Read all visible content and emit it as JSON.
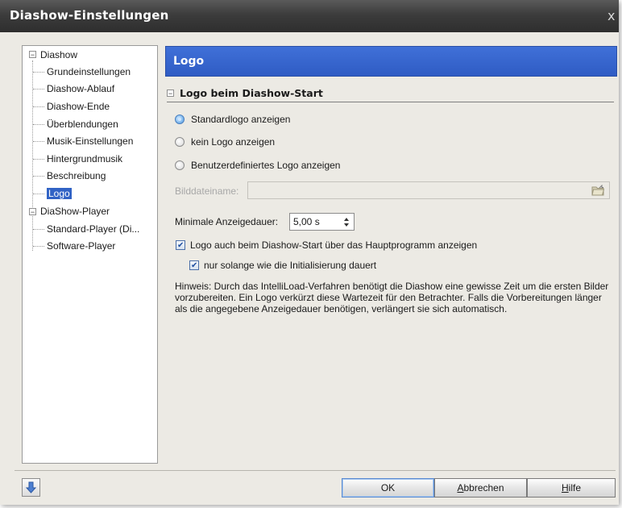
{
  "window": {
    "title": "Diashow-Einstellungen",
    "close_glyph": "x"
  },
  "tree": {
    "root1": {
      "label": "Diashow",
      "expander": "−"
    },
    "children1": [
      "Grundeinstellungen",
      "Diashow-Ablauf",
      "Diashow-Ende",
      "Überblendungen",
      "Musik-Einstellungen",
      "Hintergrundmusik",
      "Beschreibung",
      "Logo"
    ],
    "selected": "Logo",
    "root2": {
      "label": "DiaShow-Player",
      "expander": "−"
    },
    "children2": [
      "Standard-Player (Di...",
      "Software-Player"
    ]
  },
  "panel": {
    "header": "Logo",
    "group_title": "Logo beim Diashow-Start",
    "radios": [
      {
        "label": "Standardlogo anzeigen",
        "checked": true
      },
      {
        "label": "kein Logo anzeigen",
        "checked": false
      },
      {
        "label": "Benutzerdefiniertes Logo anzeigen",
        "checked": false
      }
    ],
    "file_label": "Bilddateiname:",
    "file_value": "",
    "duration_label": "Minimale Anzeigedauer:",
    "duration_value": "5,00 s",
    "check1": {
      "label": "Logo auch beim Diashow-Start über das Hauptprogramm anzeigen",
      "checked": true
    },
    "check2": {
      "label": "nur solange wie die Initialisierung dauert",
      "checked": true
    },
    "hint": "Hinweis: Durch das IntelliLoad-Verfahren benötigt die Diashow eine gewisse Zeit um die ersten Bilder vorzubereiten. Ein Logo verkürzt diese Wartezeit für den Betrachter. Falls die Vorbereitungen länger als die angegebene Anzeigedauer benötigen, verlängert sie sich automatisch."
  },
  "buttons": {
    "ok": "OK",
    "cancel_first": "A",
    "cancel_rest": "bbrechen",
    "help_first": "H",
    "help_rest": "ilfe"
  },
  "icons": {
    "close": "close-icon",
    "folder": "folder-open-icon",
    "left_action": "arrow-down-icon"
  }
}
